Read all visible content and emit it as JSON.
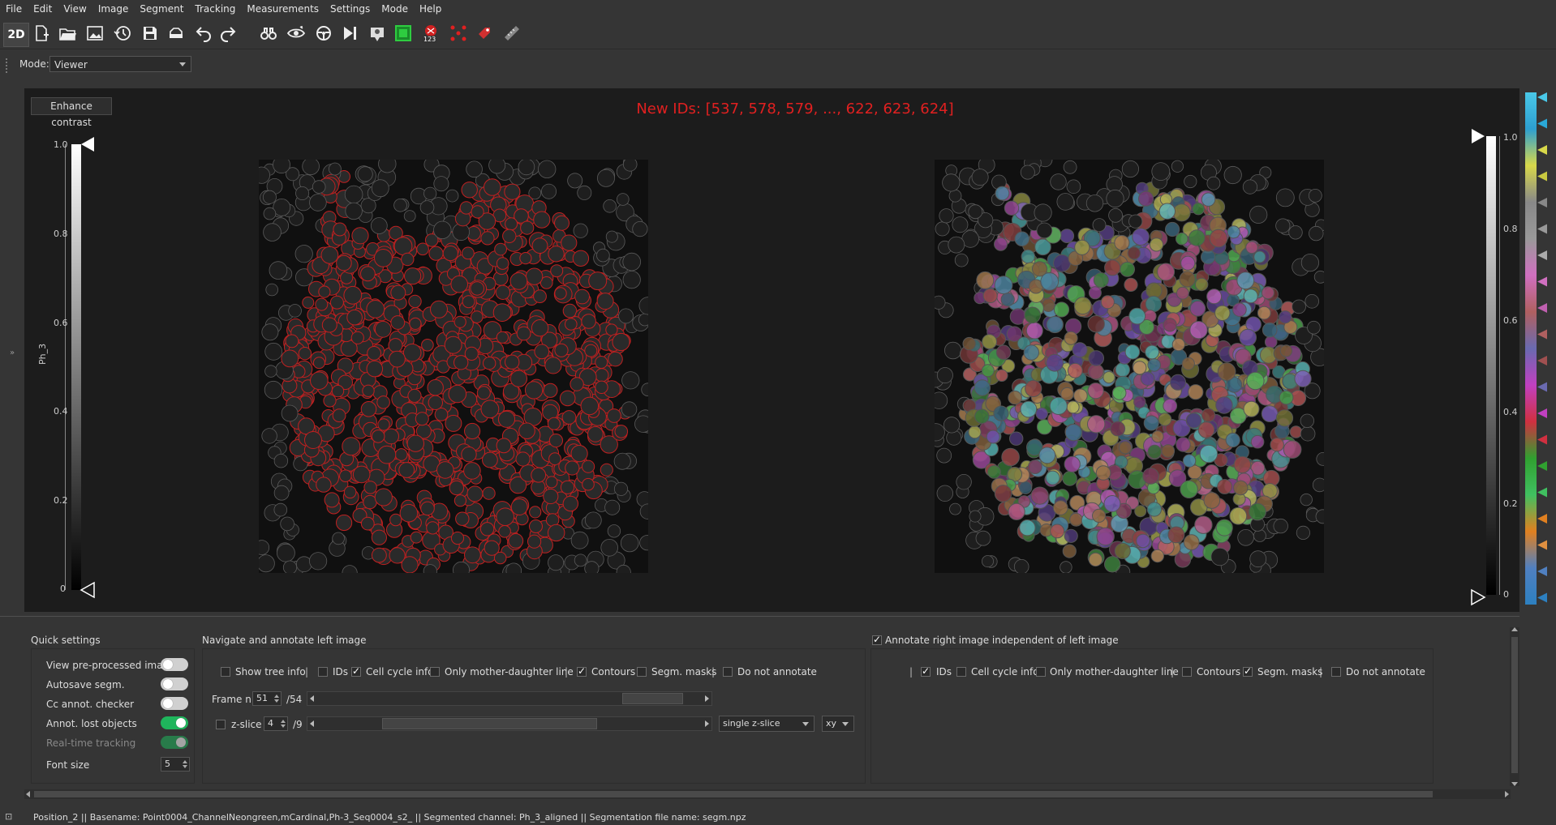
{
  "menubar": {
    "items": [
      "File",
      "Edit",
      "View",
      "Image",
      "Segment",
      "Tracking",
      "Measurements",
      "Settings",
      "Mode",
      "Help"
    ]
  },
  "toolbar": {
    "mode_2d": "2D",
    "icons": [
      "new-file-icon",
      "open-folder-icon",
      "open-image-icon",
      "history-icon",
      "save-icon",
      "cloud-icon",
      "undo-icon",
      "redo-icon",
      "binoculars-icon",
      "eye-icon",
      "steering-wheel-icon",
      "next-frame-icon",
      "manual-annotation-icon",
      "repeat-segmentation-icon",
      "assign-ids-icon",
      "points-icon",
      "label-roi-icon",
      "ruler-icon"
    ],
    "assign_ids_badge": "123"
  },
  "mode": {
    "label": "Mode:",
    "value": "Viewer"
  },
  "viewer": {
    "enhance_contrast": "Enhance contrast",
    "new_ids_text": "New IDs: [537, 578, 579, ..., 622, 623, 624]",
    "left_colorbar": {
      "ticks": [
        "1.0",
        "0.8",
        "0.6",
        "0.4",
        "0.2",
        "0"
      ],
      "label": "Ph_3"
    },
    "right_colorbar": {
      "ticks": [
        "1.0",
        "0.8",
        "0.6",
        "0.4",
        "0.2",
        "0"
      ]
    }
  },
  "quick_settings": {
    "title": "Quick settings",
    "items": [
      {
        "label": "View pre-processed image",
        "state": "off"
      },
      {
        "label": "Autosave segm.",
        "state": "off"
      },
      {
        "label": "Cc annot. checker",
        "state": "off"
      },
      {
        "label": "Annot. lost objects",
        "state": "on"
      },
      {
        "label": "Real-time tracking",
        "state": "on-disabled"
      }
    ],
    "font_size_label": "Font size",
    "font_size_value": "5"
  },
  "left_panel": {
    "title": "Navigate and annotate left image",
    "options": [
      {
        "label": "Show tree info",
        "checked": false
      },
      {
        "label": "IDs",
        "checked": false
      },
      {
        "label": "Cell cycle info",
        "checked": true
      },
      {
        "label": "Only mother-daughter line",
        "checked": false
      },
      {
        "label": "Contours",
        "checked": true
      },
      {
        "label": "Segm. masks",
        "checked": false
      },
      {
        "label": "Do not annotate",
        "checked": false
      }
    ],
    "frame_label": "Frame n.",
    "frame_value": "51",
    "frame_total": "/54",
    "zslice_label": "z-slice",
    "zslice_value": "4",
    "zslice_total": "/9",
    "zslice_mode": "single z-slice",
    "projection": "xy"
  },
  "right_panel": {
    "title": "Annotate right image independent of left image",
    "title_checked": true,
    "options": [
      {
        "label": "IDs",
        "checked": true
      },
      {
        "label": "Cell cycle info",
        "checked": false
      },
      {
        "label": "Only mother-daughter line",
        "checked": false
      },
      {
        "label": "Contours",
        "checked": false
      },
      {
        "label": "Segm. masks",
        "checked": true
      },
      {
        "label": "Do not annotate",
        "checked": false
      }
    ]
  },
  "statusbar": {
    "text": "Position_2 || Basename: Point0004_ChannelNeongreen,mCardinal,Ph-3_Seq0004_s2_ || Segmented channel: Ph_3_aligned || Segmentation file name: segm.npz"
  },
  "colors": {
    "accent_red": "#e02020",
    "toggle_on": "#1fb55c",
    "background": "#353535",
    "viewer_bg": "#1c1c1c"
  }
}
